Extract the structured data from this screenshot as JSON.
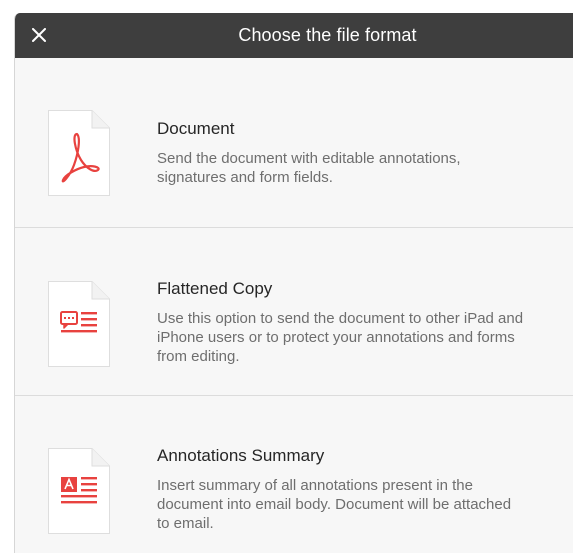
{
  "dialog": {
    "title": "Choose the file format",
    "close_icon": "close-icon"
  },
  "options": [
    {
      "title": "Document",
      "description": "Send the document with editable annotations,\nsignatures and form fields.",
      "icon": "pdf-document-icon"
    },
    {
      "title": "Flattened Copy",
      "description": "Use this option to send the document to other iPad and\niPhone users or to protect your annotations and forms\nfrom editing.",
      "icon": "flattened-copy-icon"
    },
    {
      "title": "Annotations Summary",
      "description": "Insert summary of all annotations present in the\ndocument into email body. Document will be attached\nto email.",
      "icon": "annotations-summary-icon"
    }
  ],
  "colors": {
    "header_bg": "#3e3e3e",
    "accent_red": "#e8423f",
    "sheet_bg": "#f7f7f7"
  }
}
